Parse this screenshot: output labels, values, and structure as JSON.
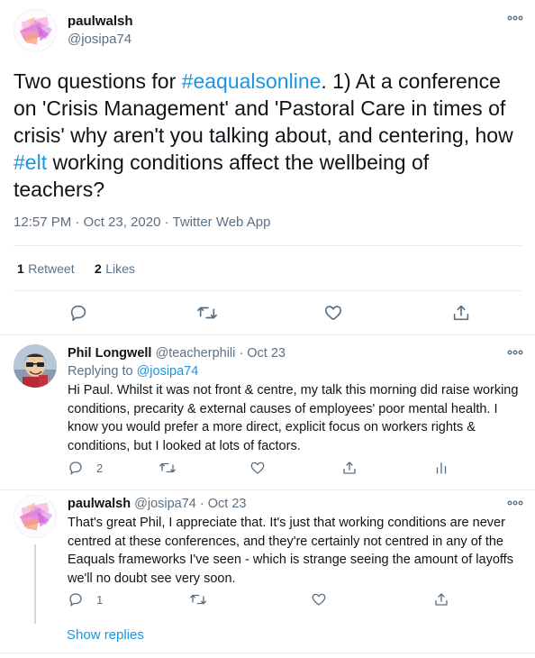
{
  "main_tweet": {
    "author_name": "paulwalsh",
    "author_handle": "@josipa74",
    "text_parts": [
      {
        "t": "Two questions for "
      },
      {
        "t": "#eaqualsonline",
        "link": true
      },
      {
        "t": ". 1) At a conference on 'Crisis Management' and 'Pastoral Care in times of crisis' why aren't you talking about, and centering, how "
      },
      {
        "t": "#elt",
        "link": true
      },
      {
        "t": " working conditions affect the wellbeing of teachers?"
      }
    ],
    "timestamp": "12:57 PM · Oct 23, 2020 · Twitter Web App",
    "retweet_count": "1",
    "retweet_label": "Retweet",
    "like_count": "2",
    "like_label": "Likes"
  },
  "replies": [
    {
      "author_name": "Phil Longwell",
      "author_handle": "@teacherphili · Oct 23",
      "replying_to_label": "Replying to ",
      "replying_to_handle": "@josipa74",
      "text": "Hi Paul. Whilst it was not front & centre, my talk this morning did raise working conditions, precarity & external causes of employees' poor mental health. I know you would prefer a more direct, explicit focus on workers rights & conditions, but I looked at lots of factors.",
      "reply_count": "2"
    },
    {
      "author_name": "paulwalsh",
      "author_handle": "@josipa74 · Oct 23",
      "text": "That's great Phil, I appreciate that. It's just that working conditions are never centred at these conferences, and they're certainly not centred in any of the Eaquals frameworks I've seen - which is strange seeing the amount of layoffs we'll no doubt see very soon.",
      "reply_count": "1"
    }
  ],
  "show_replies_label": "Show replies",
  "more_icon": "more-dots-icon",
  "icons": [
    "reply-icon",
    "retweet-icon",
    "like-icon",
    "share-icon",
    "analytics-icon"
  ],
  "colors": {
    "link": "#1b95e0",
    "secondary": "#5b7083",
    "primary_text": "#0f1419",
    "divider": "#e6ecf0"
  }
}
